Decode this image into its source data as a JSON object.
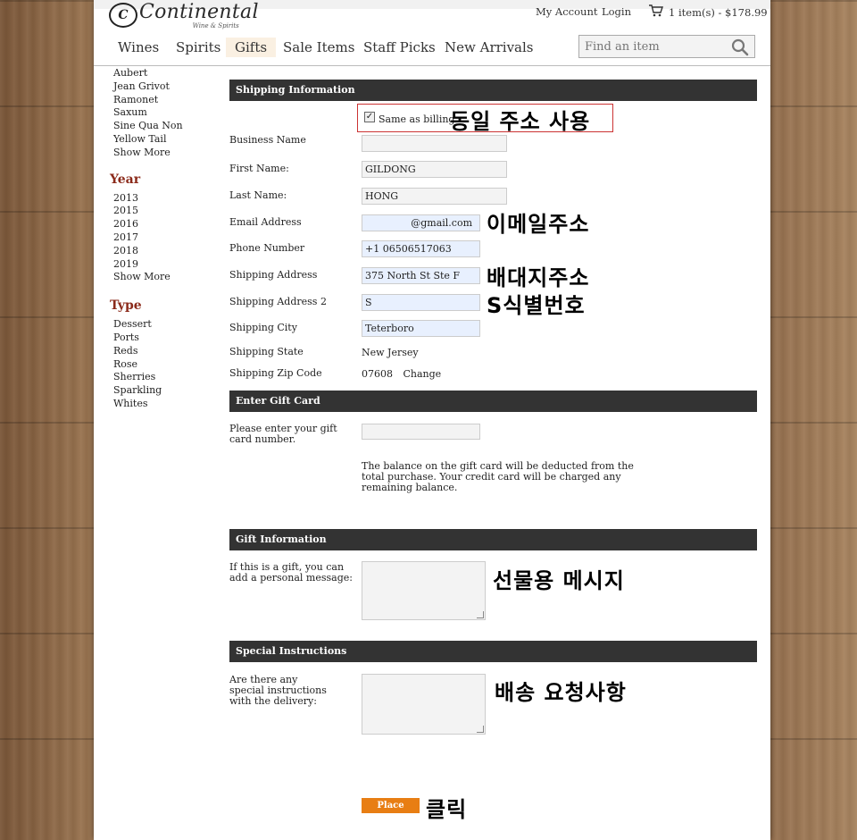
{
  "brand": {
    "name": "Continental",
    "tagline": "Wine & Spirits",
    "mark": "C"
  },
  "toplinks": {
    "account": "My Account",
    "login": "Login",
    "cart": "1 item(s) - $178.99"
  },
  "nav": {
    "items": [
      "Wines",
      "Spirits",
      "Gifts",
      "Sale Items",
      "Staff Picks",
      "New Arrivals"
    ],
    "active": "Gifts"
  },
  "search": {
    "placeholder": "Find an item"
  },
  "sidebar": {
    "producers": [
      "Aubert",
      "Jean Grivot",
      "Ramonet",
      "Saxum",
      "Sine Qua Non",
      "Yellow Tail",
      "Show More"
    ],
    "year_heading": "Year",
    "years": [
      "2013",
      "2015",
      "2016",
      "2017",
      "2018",
      "2019",
      "Show More"
    ],
    "type_heading": "Type",
    "types": [
      "Dessert",
      "Ports",
      "Reds",
      "Rose",
      "Sherries",
      "Sparkling",
      "Whites"
    ]
  },
  "shipping": {
    "heading": "Shipping Information",
    "same_as_billing": "Same as billing",
    "same_as_billing_checked": true,
    "business_name_label": "Business Name",
    "business_name": "",
    "first_name_label": "First Name:",
    "first_name": "GILDONG",
    "last_name_label": "Last Name:",
    "last_name": "HONG",
    "email_label": "Email Address",
    "email": "@gmail.com",
    "phone_label": "Phone Number",
    "phone": "+1 06506517063",
    "address_label": "Shipping Address",
    "address": "375 North St Ste F",
    "address2_label": "Shipping Address 2",
    "address2": "S",
    "city_label": "Shipping City",
    "city": "Teterboro",
    "state_label": "Shipping State",
    "state": "New Jersey",
    "zip_label": "Shipping Zip Code",
    "zip": "07608",
    "zip_change": "Change"
  },
  "gift_card": {
    "heading": "Enter Gift Card",
    "label": "Please enter your gift card number.",
    "value": "",
    "note": "The balance on the gift card will be deducted from the total purchase. Your credit card will be charged any remaining balance."
  },
  "gift_info": {
    "heading": "Gift Information",
    "label": "If this is a gift, you can add a personal message:"
  },
  "special": {
    "heading": "Special Instructions",
    "label": "Are there any special instructions with the delivery:"
  },
  "place_order": "Place Order",
  "annotations": {
    "same_address": "동일 주소 사용",
    "email": "이메일주소",
    "shipping_address": "배대지주소",
    "s_id": "S식별번호",
    "gift_message": "선물용 메시지",
    "delivery_request": "배송 요청사항",
    "click": "클릭"
  },
  "colors": {
    "accent_orange": "#e87e13",
    "section_bar": "#333333",
    "heading_red": "#8b2a1a",
    "annotation_box": "#cc3333"
  }
}
